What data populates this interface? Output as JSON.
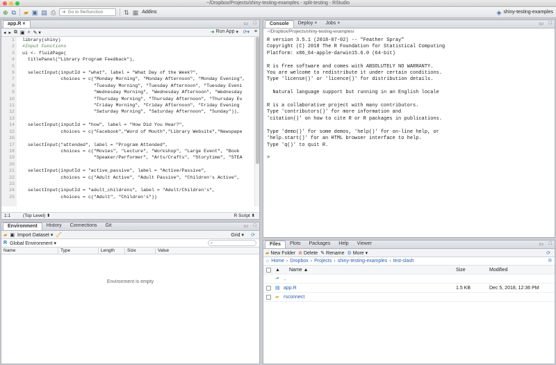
{
  "window": {
    "title": "~/Dropbox/Projects/shiny-testing-examples - split-testing - RStudio"
  },
  "toolbar": {
    "goto_placeholder": "Go to file/function",
    "addins_label": "Addins",
    "project_label": "shiny-testing-examples"
  },
  "editor": {
    "tab_label": "app.R",
    "run_app_label": "Run App",
    "line_numbers": [
      "1",
      "2",
      "3",
      "4",
      "5",
      "6",
      "7",
      "8",
      "9",
      "10",
      "11",
      "12",
      "13",
      "14",
      "15",
      "16",
      "17",
      "18",
      "19",
      "20",
      "21",
      "22",
      "23",
      "24",
      "25"
    ],
    "lines": [
      "library(shiny)",
      "#Input Functions",
      "ui <- fluidPage(",
      "  titlePanel(\"Library Program Feedback\"),",
      "",
      "  selectInput(inputId = \"what\", label = \"What Day of the Week?\",",
      "              choices = c(\"Monday Morning\", \"Monday Afternoon\", \"Monday Evening\",",
      "                          \"Tuesday Morning\", \"Tuesday Afternoon\", \"Tuesday Eveni",
      "                          \"Wednesday Morning\", \"Wednesday Afternoon\", \"Wednesday",
      "                          \"Thursday Morning\", \"Thursday Afternoon\", \"Thursday Ev",
      "                          \"Friday Morning\", \"Friday Afternoon\", \"Friday Evening",
      "                          \"Saturday Morning\", \"Saturday Afternoon\", \"Sunday\")),",
      "",
      "  selectInput(inputId = \"how\", label = \"How Did You Hear?\",",
      "              choices = c(\"Facebook\",\"Word of Mouth\",\"Library Website\",\"Newspape",
      "",
      "  selectInput(\"attended\", label = \"Program Attended\",",
      "              choices = c(\"Movies\", \"Lecture\", \"Workshop\", \"Large Event\", \"Book",
      "                          \"Speaker/Performer\", \"Arts/Crafts\", \"Storytime\", \"STEA",
      "",
      "  selectInput(inputId = \"active_passive\", label = \"Active/Passive\",",
      "              choices = c(\"Adult Active\", \"Adult Passive\", \"Children's Active\",",
      "",
      "  selectInput(inputId = \"adult_childrens\", label = \"Adult/Children's\",",
      "              choices = c(\"Adult\", \"Children's\"))"
    ],
    "status_position": "1:1",
    "status_scope": "(Top Level) ⬍",
    "status_type": "R Script ⬍"
  },
  "env": {
    "tabs": [
      "Environment",
      "History",
      "Connections",
      "Git"
    ],
    "import_label": "Import Dataset ▾",
    "grid_label": "Grid ▾",
    "scope_label": "Global Environment ▾",
    "columns": [
      "Name",
      "Type",
      "Length",
      "Size",
      "Value"
    ],
    "empty_message": "Environment is empty"
  },
  "console": {
    "tabs": [
      "Console",
      "Deploy",
      "Jobs"
    ],
    "path": "~/Dropbox/Projects/shiny-testing-examples/",
    "text": "R version 3.5.1 (2018-07-02) -- \"Feather Spray\"\nCopyright (C) 2018 The R Foundation for Statistical Computing\nPlatform: x86_64-apple-darwin15.6.0 (64-bit)\n\nR is free software and comes with ABSOLUTELY NO WARRANTY.\nYou are welcome to redistribute it under certain conditions.\nType 'license()' or 'licence()' for distribution details.\n\n  Natural language support but running in an English locale\n\nR is a collaborative project with many contributors.\nType 'contributors()' for more information and\n'citation()' on how to cite R or R packages in publications.\n\nType 'demo()' for some demos, 'help()' for on-line help, or\n'help.start()' for an HTML browser interface to help.\nType 'q()' to quit R.\n\n> "
  },
  "files": {
    "tabs": [
      "Files",
      "Plots",
      "Packages",
      "Help",
      "Viewer"
    ],
    "new_folder": "New Folder",
    "delete": "Delete",
    "rename": "Rename",
    "more": "More ▾",
    "breadcrumb": [
      "Home",
      "Dropbox",
      "Projects",
      "shiny-testing-examples",
      "test-slash"
    ],
    "columns": {
      "name": "Name ▲",
      "size": "Size",
      "modified": "Modified"
    },
    "up": "..",
    "rows": [
      {
        "name": "app.R",
        "size": "1.5 KB",
        "modified": "Dec 5, 2018, 12:36 PM"
      },
      {
        "name": "rsconnect",
        "size": "",
        "modified": ""
      }
    ]
  },
  "colors": {
    "accent": "#4a6ea9",
    "folder": "#e0b44a",
    "run": "#2f8a2f"
  }
}
